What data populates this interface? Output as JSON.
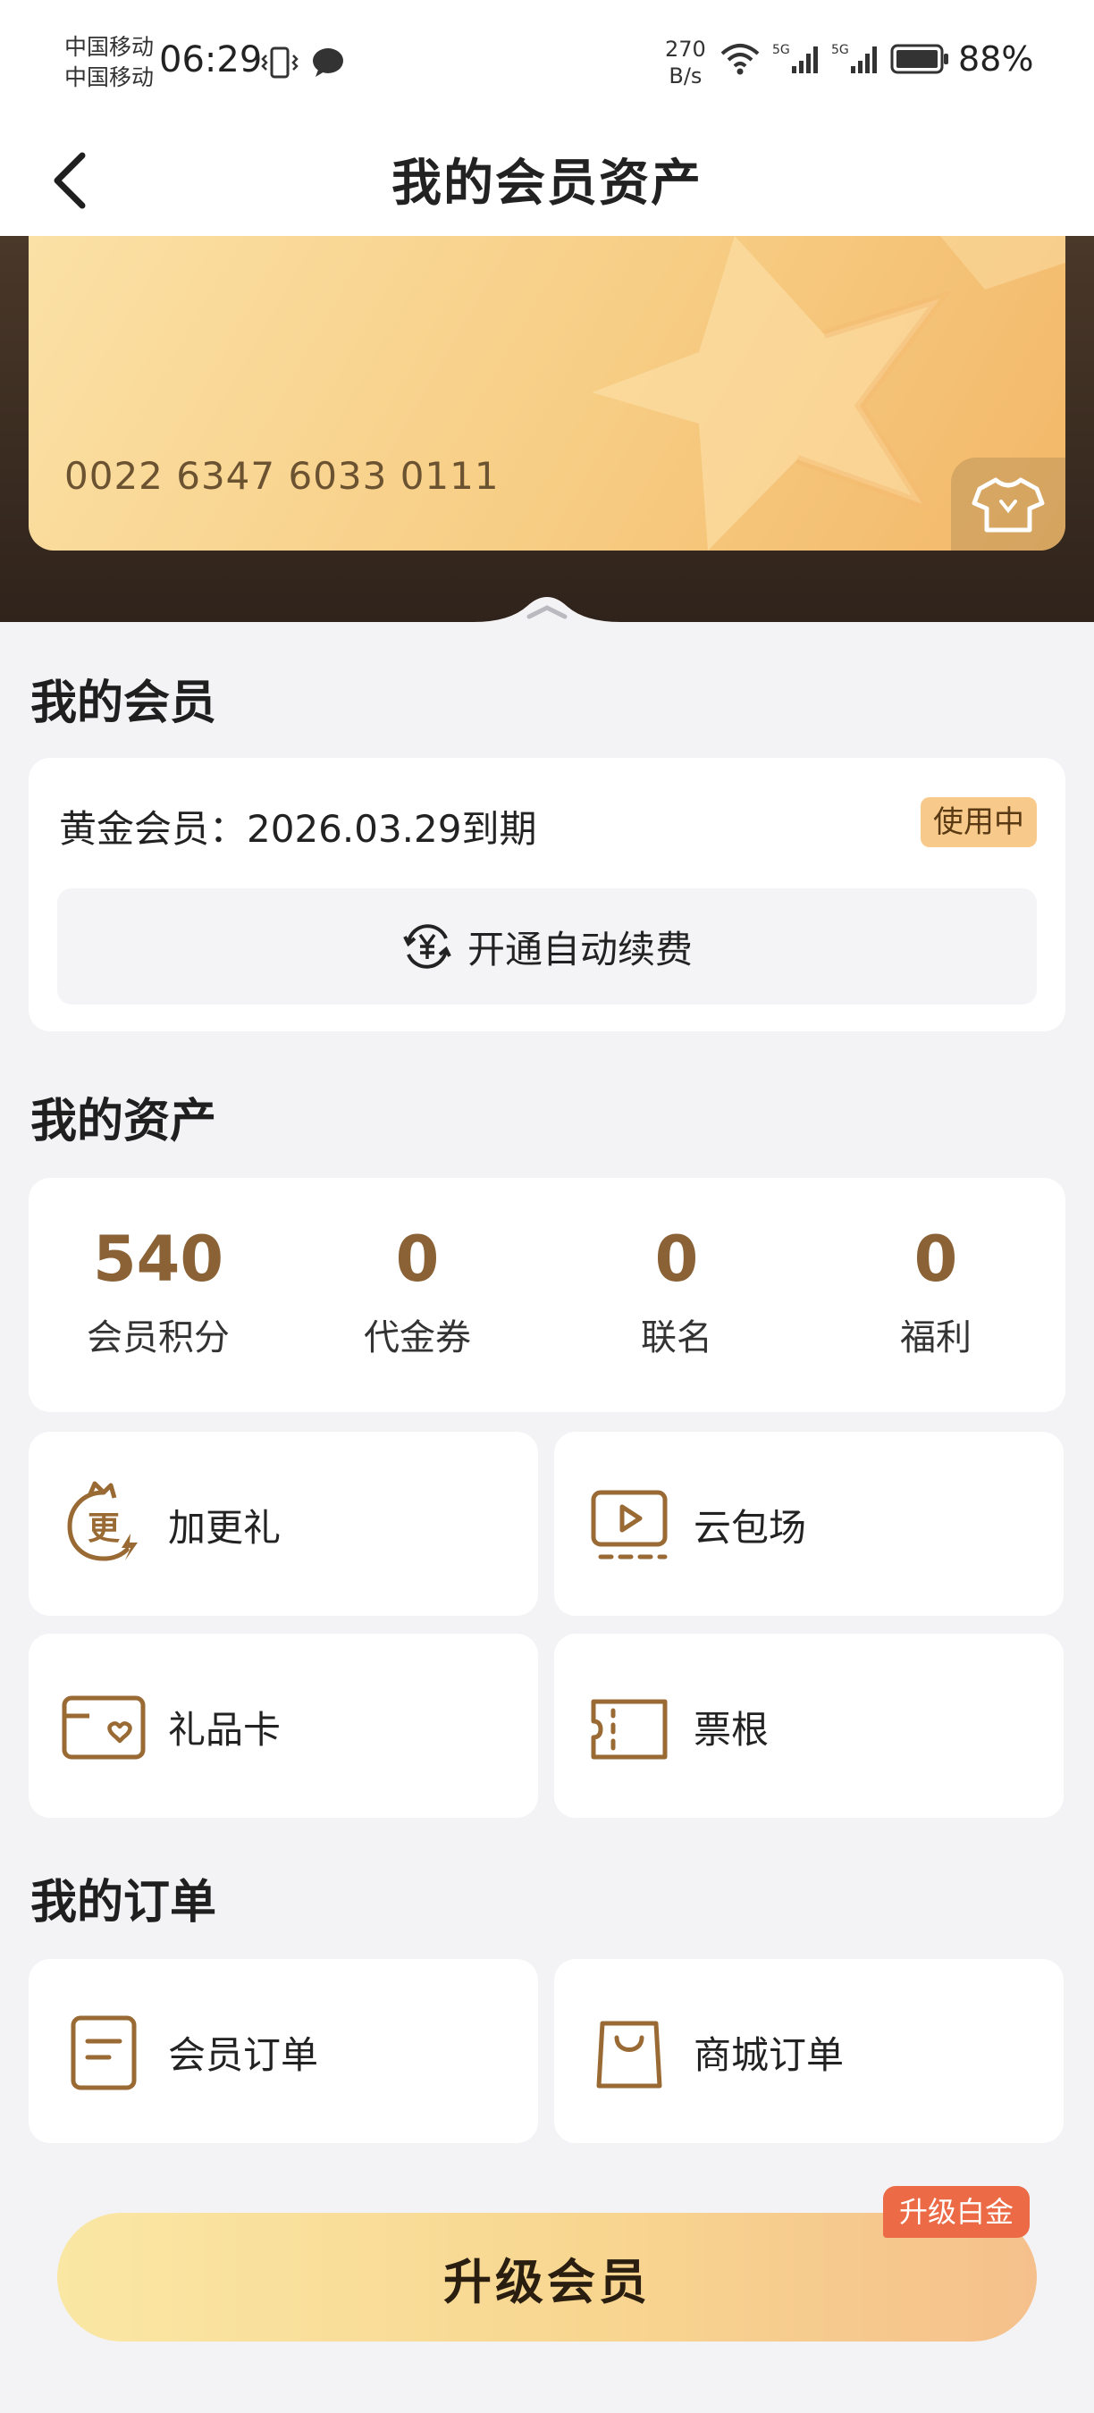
{
  "status_bar": {
    "carrier_1": "中国移动",
    "carrier_2": "中国移动",
    "time": "06:29",
    "net_speed_value": "270",
    "net_speed_unit": "B/s",
    "battery": "88%"
  },
  "nav": {
    "title": "我的会员资产"
  },
  "card": {
    "number": "0022 6347 6033 0111"
  },
  "membership": {
    "section_title": "我的会员",
    "line": "黄金会员：2026.03.29到期",
    "status": "使用中",
    "auto_renew_label": "开通自动续费"
  },
  "assets": {
    "section_title": "我的资产",
    "stats": [
      {
        "value": "540",
        "label": "会员积分"
      },
      {
        "value": "0",
        "label": "代金券"
      },
      {
        "value": "0",
        "label": "联名"
      },
      {
        "value": "0",
        "label": "福利"
      }
    ],
    "tiles": [
      {
        "label": "加更礼",
        "icon": "bonus-gift-icon"
      },
      {
        "label": "云包场",
        "icon": "cloud-screening-icon"
      },
      {
        "label": "礼品卡",
        "icon": "gift-card-icon"
      },
      {
        "label": "票根",
        "icon": "ticket-stub-icon"
      }
    ]
  },
  "orders": {
    "section_title": "我的订单",
    "tiles": [
      {
        "label": "会员订单",
        "icon": "document-icon"
      },
      {
        "label": "商城订单",
        "icon": "shopping-bag-icon"
      }
    ]
  },
  "footer": {
    "upgrade_label": "升级会员",
    "upgrade_tag": "升级白金"
  },
  "colors": {
    "accent_gold": "#8a6236",
    "card_gold": "#f7cd84",
    "badge": "#f7c98a",
    "tag_orange": "#ec6a45"
  }
}
